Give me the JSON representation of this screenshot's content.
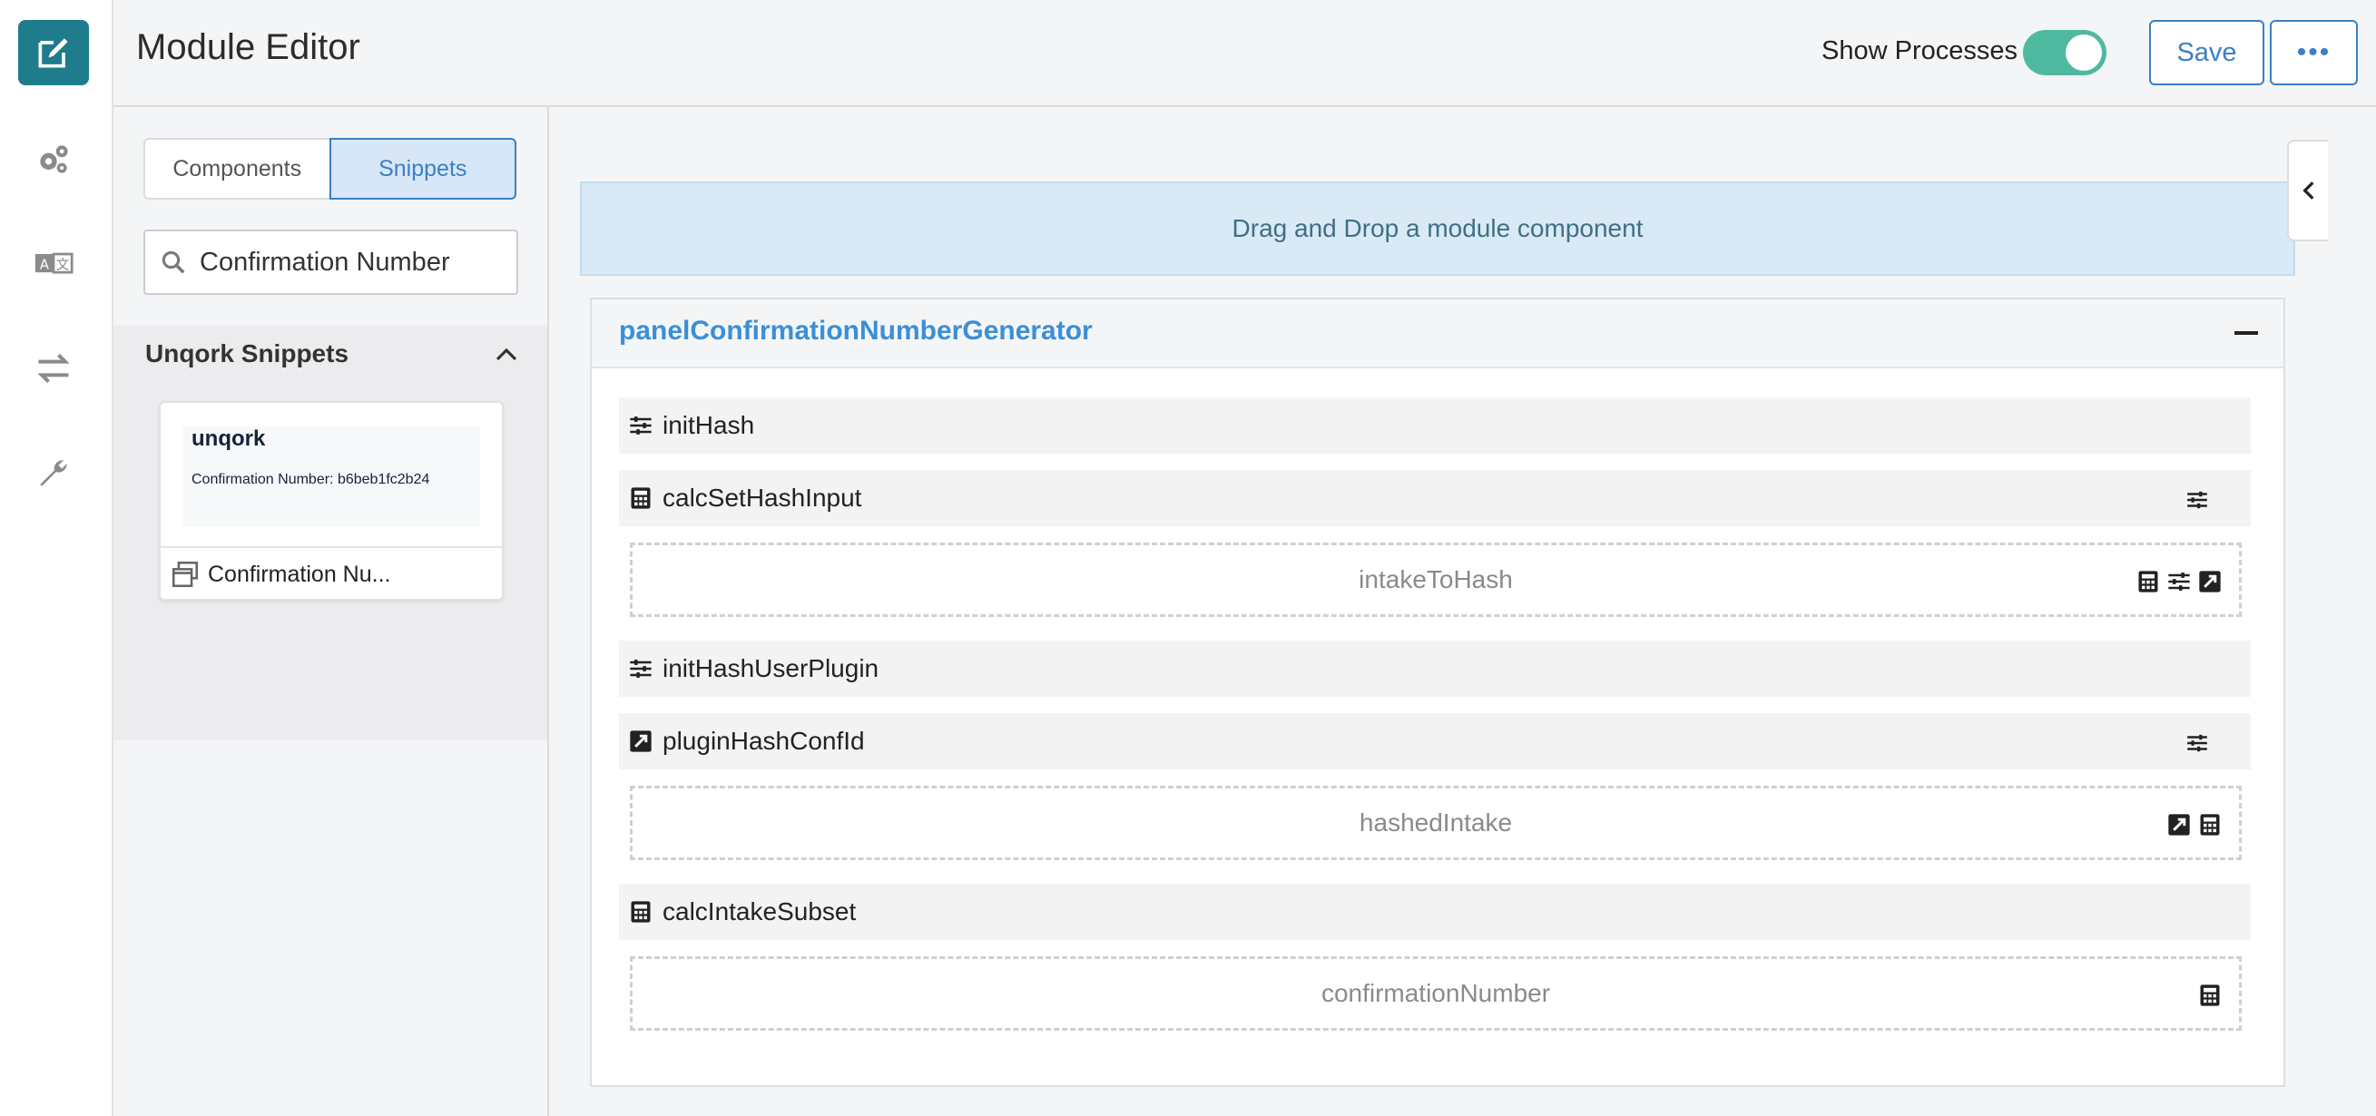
{
  "header": {
    "title": "Module Editor",
    "show_processes_label": "Show Processes",
    "show_processes_on": true,
    "save_label": "Save",
    "more_label": "•••"
  },
  "rail": {
    "items": [
      "edit-icon",
      "gears-icon",
      "translate-icon",
      "transfer-arrows-icon",
      "wrench-icon"
    ]
  },
  "left_panel": {
    "tabs": [
      {
        "label": "Components",
        "selected": false
      },
      {
        "label": "Snippets",
        "selected": true
      }
    ],
    "search_value": "Confirmation Number",
    "section_title": "Unqork Snippets",
    "card": {
      "logo": "unqork",
      "preview_text": "Confirmation Number: b6beb1fc2b24",
      "label": "Confirmation Nu..."
    }
  },
  "canvas": {
    "drop_text": "Drag and Drop a module component",
    "panel_name": "panelConfirmationNumberGenerator",
    "rows": [
      {
        "label": "initHash",
        "icon": "sliders-icon"
      },
      {
        "label": "calcSetHashInput",
        "icon": "calculator-icon"
      },
      {
        "label": "intakeToHash"
      },
      {
        "label": "initHashUserPlugin",
        "icon": "sliders-icon"
      },
      {
        "label": "pluginHashConfId",
        "icon": "plugin-icon"
      },
      {
        "label": "hashedIntake"
      },
      {
        "label": "calcIntakeSubset",
        "icon": "calculator-icon"
      },
      {
        "label": "confirmationNumber"
      }
    ]
  },
  "colors": {
    "accent": "#3b7fc4",
    "rail_active": "#1f7c8c",
    "toggle_on": "#4fb99f",
    "panel_name": "#3b8fd6",
    "drop_bg": "#d9eaf6"
  }
}
